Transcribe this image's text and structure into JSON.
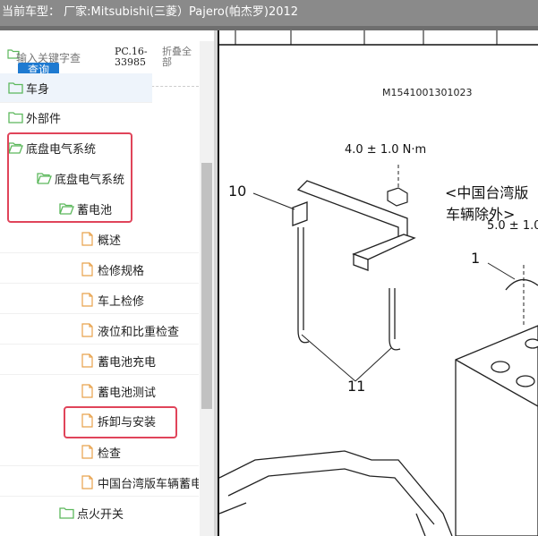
{
  "window": {
    "title": "当前车型： 厂家:Mitsubishi(三菱）Pajero(帕杰罗)2012"
  },
  "sidebar": {
    "search": {
      "placeholder": "输入关键字查",
      "button_label": "查询"
    },
    "pc_code": "PC.16-33985",
    "collapse_all_label": "折叠全部",
    "items": [
      {
        "label": "车身",
        "icon": "folder-icon"
      },
      {
        "label": "外部件",
        "icon": "folder-icon"
      },
      {
        "label": "底盘电气系统",
        "icon": "folder-icon"
      },
      {
        "label": "底盘电气系统",
        "icon": "folder-icon"
      },
      {
        "label": "蓄电池",
        "icon": "folder-icon"
      },
      {
        "label": "概述",
        "icon": "document-icon"
      },
      {
        "label": "检修规格",
        "icon": "document-icon"
      },
      {
        "label": "车上检修",
        "icon": "document-icon"
      },
      {
        "label": "液位和比重检查",
        "icon": "document-icon"
      },
      {
        "label": "蓄电池充电",
        "icon": "document-icon"
      },
      {
        "label": "蓄电池测试",
        "icon": "document-icon"
      },
      {
        "label": "拆卸与安装",
        "icon": "document-icon"
      },
      {
        "label": "检查",
        "icon": "document-icon"
      },
      {
        "label": "中国台湾版车辆蓄电",
        "icon": "document-icon"
      },
      {
        "label": "点火开关",
        "icon": "folder-icon"
      }
    ]
  },
  "diagram": {
    "code": "M1541001301023",
    "torque_top": "4.0 ± 1.0 N·m",
    "torque_right": "5.0 ± 1.0",
    "note_line1": "<中国台湾版",
    "note_line2": "车辆除外>",
    "callout_10": "10",
    "callout_11": "11",
    "callout_1": "1"
  },
  "colors": {
    "titlebar_bg": "#8a8a8a",
    "highlight_border": "#e0445a",
    "button_blue": "#1e7ad1",
    "folder_green": "#5cb85c",
    "document_orange": "#e8a24c"
  }
}
